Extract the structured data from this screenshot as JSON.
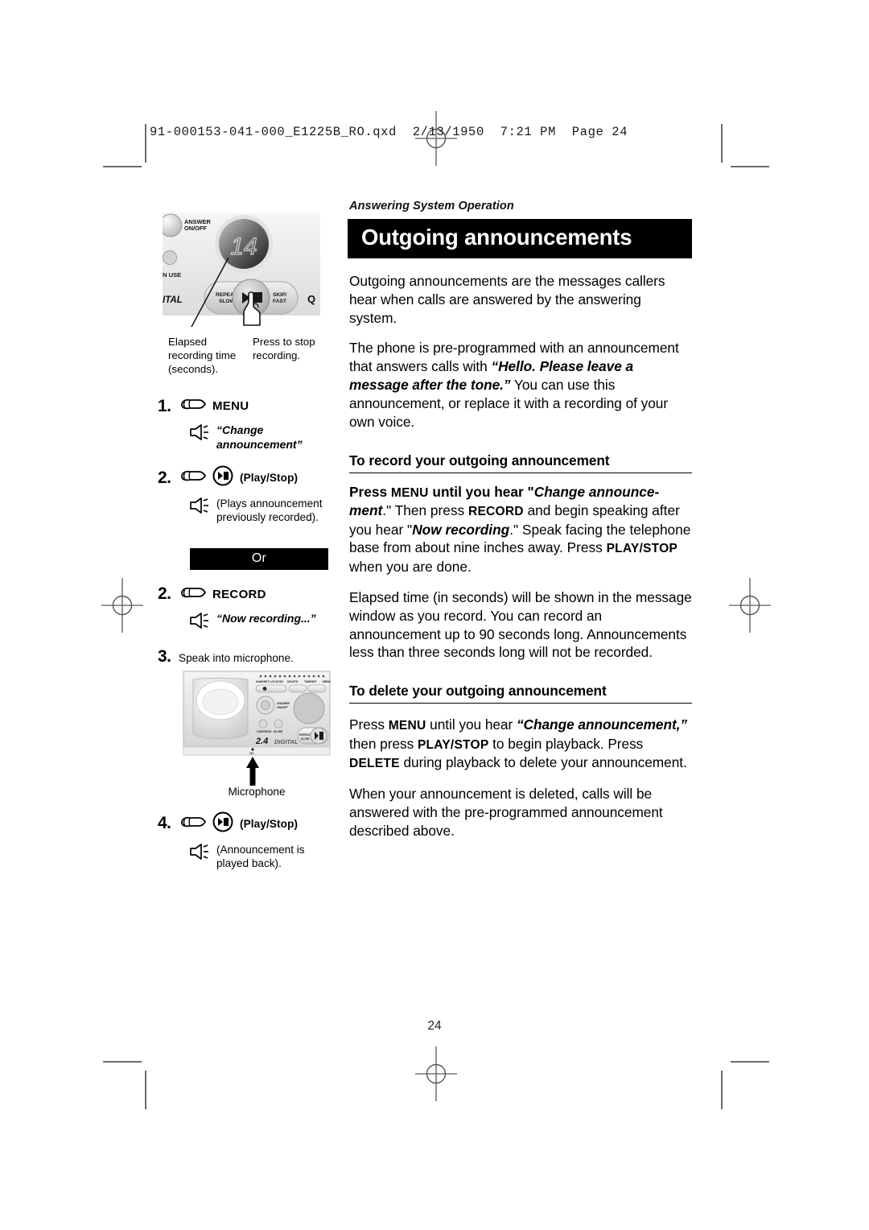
{
  "prepress": {
    "header_line": "91-000153-041-000_E1225B_RO.qxd  2/13/1950  7:21 PM  Page 24",
    "folio": "24"
  },
  "right_column": {
    "running_head": "Answering System Operation",
    "chapter_title": "Outgoing announcements",
    "intro_paragraph": "Outgoing announcements are the messages callers hear when calls are answered by the answering system.",
    "preprogrammed_paragraph": {
      "before": "The phone is pre-programmed with an announcement that answers calls with ",
      "quote": "“Hello. Please leave a message after the tone.”",
      "after": " You can use this announcement, or replace it with a recording of your own voice."
    },
    "record_section": {
      "heading": "To record your outgoing announcement",
      "p1_a": "Press ",
      "p1_menu": "MENU",
      "p1_b": " until you hear \"",
      "p1_change": "Change announce-ment",
      "p1_c": ".\" Then press ",
      "p1_record": "RECORD",
      "p1_d": " and begin speaking after you hear \"",
      "p1_now": "Now recording",
      "p1_e": ".\" Speak facing the telephone base from about nine inches away. Press ",
      "p1_playstop": "PLAY/STOP",
      "p1_f": " when you are done.",
      "p2": "Elapsed time (in seconds) will be shown in the message window as you record. You can record an announcement up to 90 seconds long. Announcements less than three seconds long will not be recorded."
    },
    "delete_section": {
      "heading": "To delete your outgoing announcement",
      "p1_a": "Press ",
      "p1_menu": "MENU",
      "p1_b": " until you hear ",
      "p1_change": "“Change announcement,”",
      "p1_c": " then press ",
      "p1_playstop": "PLAY/STOP",
      "p1_d": " to begin playback. Press ",
      "p1_delete": "DELETE",
      "p1_e": " during playback to delete your announcement.",
      "p2": "When your announcement is deleted, calls will be answered with the pre-programmed announcement described above."
    }
  },
  "left_column": {
    "top_illustration": {
      "display_value": "14",
      "labels": {
        "answer_onoff": "ANSWER\nON/OFF",
        "in_use": "N USE",
        "digital": "ITAL",
        "repeat_slow": "REPEAT/\nSLOW",
        "skip_fast": "SKIP/\nFAST",
        "right_edge": "Q"
      }
    },
    "callouts": {
      "left": "Elapsed recording time (seconds).",
      "right": "Press to stop recording."
    },
    "steps": [
      {
        "number": "1.",
        "button_label": "MENU",
        "voice_prompt": "“Change announcement”",
        "voice_style": "quote"
      },
      {
        "number": "2.",
        "button_label": "(Play/Stop)",
        "voice_prompt": "(Plays announcement previously recorded).",
        "voice_style": "plain"
      }
    ],
    "or_divider": "Or",
    "steps_alt": [
      {
        "number": "2.",
        "button_label": "RECORD",
        "voice_prompt": "“Now recording...”",
        "voice_style": "quote"
      }
    ],
    "step3": {
      "number": "3.",
      "text": "Speak into microphone."
    },
    "base_illustration": {
      "mic_label": "Microphone",
      "logo": "2.4 DIGITAL",
      "top_buttons": "HANDSET LOCATOR   DELETE   TIME/SET   MENU",
      "answer_onoff": "ANSWER\nON/OFF",
      "charging": "CHARGING",
      "in_use": "IN USE",
      "repeat_slow": "REPEAT/\nSLOW",
      "mic_dot": "MIC"
    },
    "step4": {
      "number": "4.",
      "button_label": "(Play/Stop)",
      "voice_prompt": "(Announcement is played back)."
    }
  }
}
